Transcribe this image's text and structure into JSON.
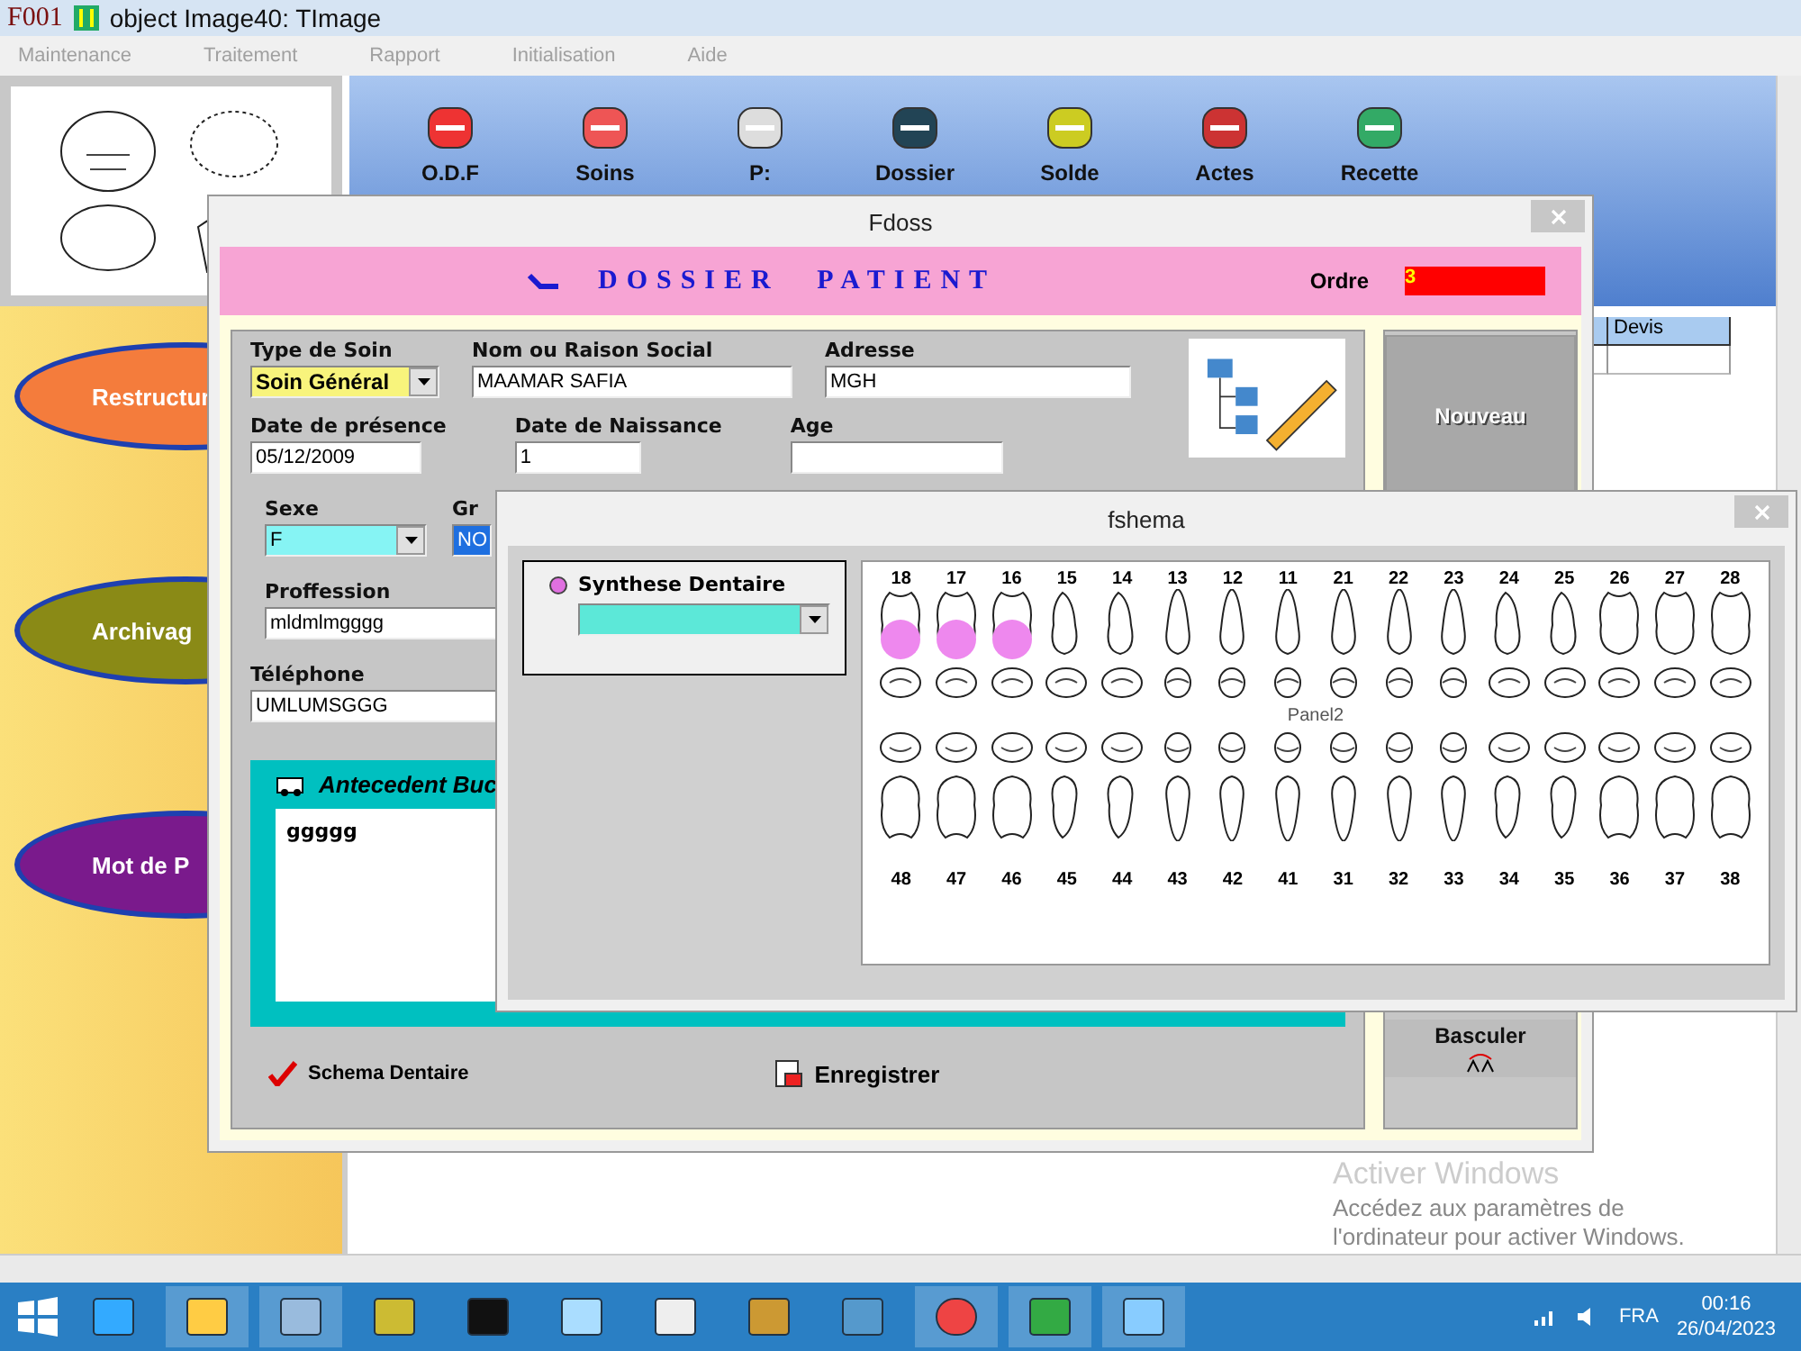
{
  "app": {
    "title": "object Image40: TImage",
    "overlay_text": "F001",
    "menu": [
      {
        "label": "Maintenance",
        "disabled": true
      },
      {
        "label": "Traitement",
        "disabled": true
      },
      {
        "label": "Rapport",
        "disabled": true
      },
      {
        "label": "Initialisation",
        "disabled": true
      },
      {
        "label": "Aide",
        "disabled": true
      }
    ],
    "toolbar": [
      {
        "label": "O.D.F"
      },
      {
        "label": "Soins"
      },
      {
        "label": "P:"
      },
      {
        "label": "Dossier"
      },
      {
        "label": "Solde"
      },
      {
        "label": "Actes"
      },
      {
        "label": "Recette"
      }
    ],
    "sidebar": [
      {
        "label": "Restructur",
        "color": "#f47c3c"
      },
      {
        "label": "Archivag",
        "color": "#8a8a16"
      },
      {
        "label": "Mot de P",
        "color": "#7a1a8c"
      }
    ],
    "grid": {
      "columns": [
        "",
        "Devis"
      ]
    }
  },
  "fdoss": {
    "title": "Fdoss",
    "heading": "DOSSIER PATIENT",
    "order_label": "Ordre",
    "order_value": "3",
    "rows": [
      [
        {
          "kind": "select",
          "label": "Type de Soin",
          "value": "Soin Général",
          "color": "#f8f47c"
        },
        {
          "kind": "text",
          "label": "Nom ou Raison Social",
          "value": "MAAMAR SAFIA"
        },
        {
          "kind": "text",
          "label": "Adresse",
          "value": "MGH"
        }
      ],
      [
        {
          "kind": "text",
          "label": "Date de présence",
          "value": "05/12/2009"
        },
        {
          "kind": "text",
          "label": "Date de Naissance",
          "value": "1"
        },
        {
          "kind": "text",
          "label": "Age"
        }
      ],
      [
        {
          "kind": "select",
          "label": "Sexe",
          "value": "F",
          "color": "#86f4f4"
        },
        {
          "kind": "text",
          "label": "Gr",
          "value": "NO",
          "color": "#1e6fe0"
        }
      ],
      [
        {
          "kind": "text",
          "label": "Proffession",
          "value": "mldmlmgggg"
        }
      ],
      [
        {
          "kind": "text",
          "label": "Téléphone",
          "value": "UMLUMSGGG"
        }
      ]
    ],
    "antecedent": {
      "title": "Antecedent Buc",
      "value": "ggggg"
    },
    "schema": {
      "label": "Schema Dentaire",
      "checked": true
    },
    "save_label": "Enregistrer",
    "side_buttons": [
      {
        "label": "Nouveau",
        "disabled": true
      },
      {
        "label": "Basculer",
        "disabled": false
      }
    ]
  },
  "fshema": {
    "title": "fshema",
    "option": {
      "label": "Synthese Dentaire",
      "selected": true
    },
    "panel_label": "Panel2",
    "upper": [
      {
        "number": "18",
        "marked": true
      },
      {
        "number": "17",
        "marked": true
      },
      {
        "number": "16",
        "marked": true
      },
      {
        "number": "15",
        "marked": false
      },
      {
        "number": "14",
        "marked": false
      },
      {
        "number": "13",
        "marked": false
      },
      {
        "number": "12",
        "marked": false
      },
      {
        "number": "11",
        "marked": false
      },
      {
        "number": "21",
        "marked": false
      },
      {
        "number": "22",
        "marked": false
      },
      {
        "number": "23",
        "marked": false
      },
      {
        "number": "24",
        "marked": false
      },
      {
        "number": "25",
        "marked": false
      },
      {
        "number": "26",
        "marked": false
      },
      {
        "number": "27",
        "marked": false
      },
      {
        "number": "28",
        "marked": false
      }
    ],
    "lower": [
      {
        "number": "48",
        "marked": false
      },
      {
        "number": "47",
        "marked": false
      },
      {
        "number": "46",
        "marked": false
      },
      {
        "number": "45",
        "marked": false
      },
      {
        "number": "44",
        "marked": false
      },
      {
        "number": "43",
        "marked": false
      },
      {
        "number": "42",
        "marked": false
      },
      {
        "number": "41",
        "marked": false
      },
      {
        "number": "31",
        "marked": false
      },
      {
        "number": "32",
        "marked": false
      },
      {
        "number": "33",
        "marked": false
      },
      {
        "number": "34",
        "marked": false
      },
      {
        "number": "35",
        "marked": false
      },
      {
        "number": "36",
        "marked": false
      },
      {
        "number": "37",
        "marked": false
      },
      {
        "number": "38",
        "marked": false
      }
    ]
  },
  "activation": {
    "title": "Activer Windows",
    "lines": [
      "Accédez aux paramètres de",
      "l'ordinateur pour activer Windows."
    ]
  },
  "taskbar": {
    "language": "FRA",
    "time": "00:16",
    "date": "26/04/2023"
  }
}
